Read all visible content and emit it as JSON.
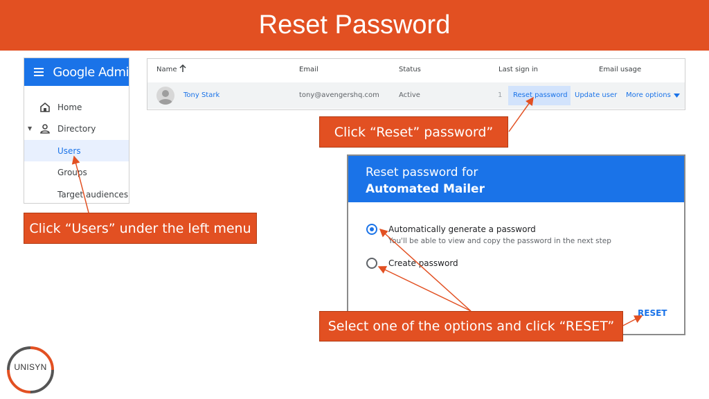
{
  "slide": {
    "title": "Reset Password"
  },
  "sidebar": {
    "brand": "Google Admi",
    "items": [
      {
        "label": "Home",
        "icon": "home-icon"
      },
      {
        "label": "Directory",
        "icon": "person-icon"
      },
      {
        "label": "Users",
        "active": true
      },
      {
        "label": "Groups"
      },
      {
        "label": "Target audiences"
      }
    ]
  },
  "users_table": {
    "headers": [
      "Name",
      "Email",
      "Status",
      "Last sign in",
      "Email usage"
    ],
    "row": {
      "name": "Tony Stark",
      "email": "tony@avengershq.com",
      "status": "Active",
      "last_sign_in": "1",
      "actions": [
        "Reset password",
        "Update user",
        "More options"
      ]
    }
  },
  "dialog": {
    "title_line1": "Reset password for",
    "title_line2": "Automated Mailer",
    "options": [
      {
        "label": "Automatically generate a password",
        "help": "You'll be able to view and copy the password in the next step",
        "selected": true
      },
      {
        "label": "Create password",
        "selected": false
      }
    ],
    "reset_label": "RESET"
  },
  "callouts": {
    "reset": "Click “Reset” password”",
    "users": "Click “Users” under the left menu",
    "options": "Select one of the options and click “RESET”"
  },
  "logo": {
    "text": "UNISYN"
  },
  "colors": {
    "accent": "#e25022",
    "google_blue": "#1a73e8"
  }
}
